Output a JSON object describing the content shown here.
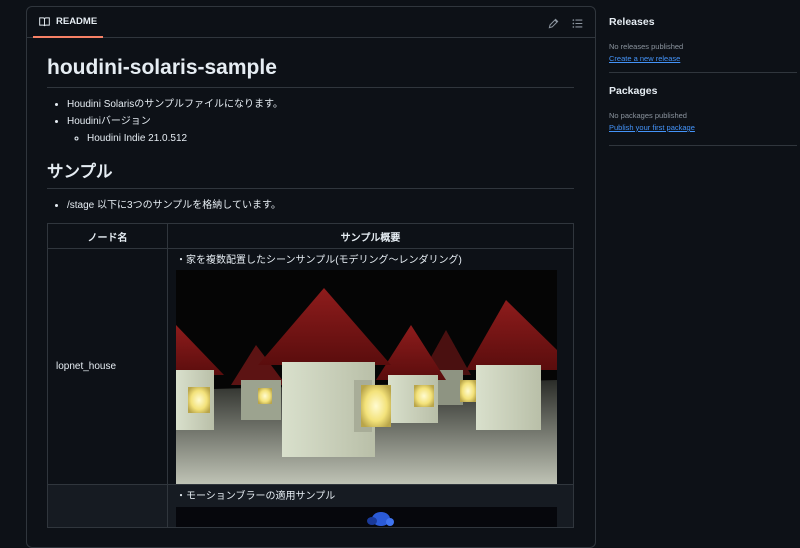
{
  "readme": {
    "tab_label": "README",
    "tab_icon": "book-icon",
    "edit_icon": "pencil-icon",
    "outline_icon": "list-unordered-icon",
    "title": "houdini-solaris-sample",
    "intro_items": [
      "Houdini Solarisのサンプルファイルになります。",
      "Houdiniバージョン"
    ],
    "version_items": [
      "Houdini Indie 21.0.512"
    ],
    "section_title": "サンプル",
    "stage_item": "/stage 以下に3つのサンプルを格納しています。",
    "table": {
      "headers": [
        "ノード名",
        "サンプル概要"
      ],
      "rows": [
        {
          "name": "lopnet_house",
          "description": "・家を複数配置したシーンサンプル(モデリング～レンダリング)"
        },
        {
          "name": "",
          "description": "・モーションブラーの適用サンプル"
        }
      ]
    }
  },
  "sidebar": {
    "releases": {
      "title": "Releases",
      "status": "No releases published",
      "link": "Create a new release"
    },
    "packages": {
      "title": "Packages",
      "status": "No packages published",
      "link": "Publish your first package"
    }
  },
  "colors": {
    "background": "#0d1117",
    "border": "#30363d",
    "link": "#4493f8",
    "tab_underline": "#f78166",
    "muted_text": "#8b949e"
  }
}
